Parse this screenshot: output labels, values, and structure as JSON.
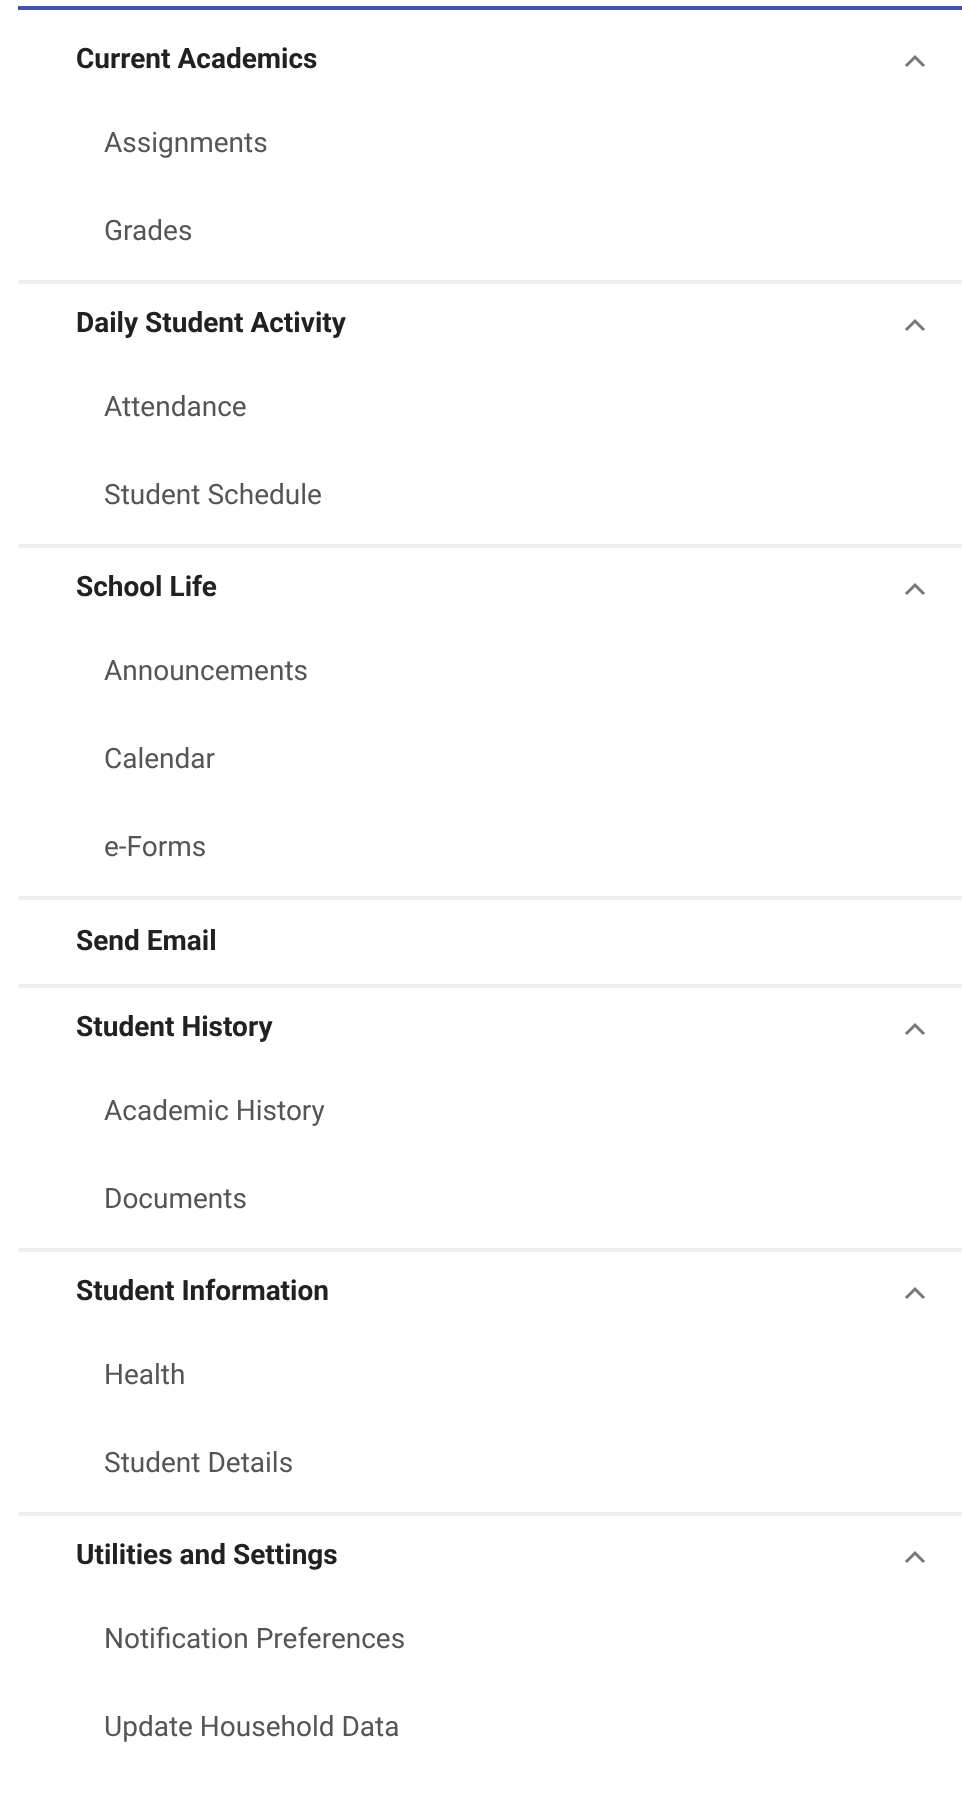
{
  "sections": [
    {
      "kind": "group",
      "label": "Current Academics",
      "expanded": true,
      "items": [
        "Assignments",
        "Grades"
      ]
    },
    {
      "kind": "group",
      "label": "Daily Student Activity",
      "expanded": true,
      "items": [
        "Attendance",
        "Student Schedule"
      ]
    },
    {
      "kind": "group",
      "label": "School Life",
      "expanded": true,
      "items": [
        "Announcements",
        "Calendar",
        "e-Forms"
      ]
    },
    {
      "kind": "link",
      "label": "Send Email"
    },
    {
      "kind": "group",
      "label": "Student History",
      "expanded": true,
      "items": [
        "Academic History",
        "Documents"
      ]
    },
    {
      "kind": "group",
      "label": "Student Information",
      "expanded": true,
      "items": [
        "Health",
        "Student Details"
      ]
    },
    {
      "kind": "group",
      "label": "Utilities and Settings",
      "expanded": true,
      "items": [
        "Notification Preferences",
        "Update Household Data"
      ]
    }
  ]
}
